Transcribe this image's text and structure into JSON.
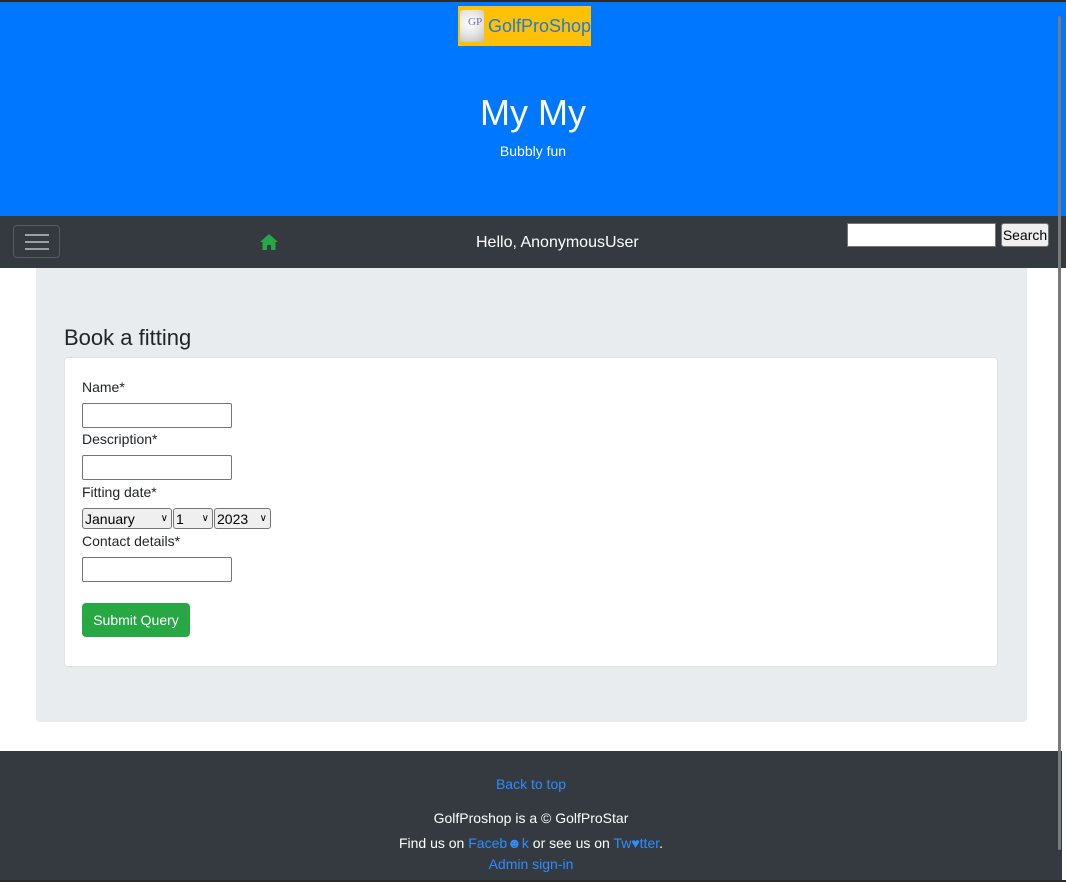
{
  "header": {
    "logo_text": "GolfProShop",
    "logo_mark": "GP",
    "title": "My My",
    "subtitle": "Bubbly fun"
  },
  "navbar": {
    "toggler_icon": "hamburger-icon",
    "home_icon": "home-icon",
    "greeting": "Hello, AnonymousUser",
    "search_value": "",
    "search_button": "Search"
  },
  "form": {
    "title": "Book a fitting",
    "name_label": "Name*",
    "description_label": "Description*",
    "fitting_date_label": "Fitting date*",
    "month": "January",
    "day": "1",
    "year": "2023",
    "contact_label": "Contact details*",
    "submit_label": "Submit Query"
  },
  "footer": {
    "back_to_top": "Back to top",
    "copyright": "GolfProshop is a © GolfProStar",
    "find_us_prefix": "Find us on ",
    "facebook": "Faceb☻k",
    "or_see": " or see us on ",
    "twitter": "Tw♥tter",
    "period": ".",
    "admin_link": "Admin sign-in"
  },
  "colors": {
    "hero": "#0077ff",
    "navbar": "#343a40",
    "panel": "#e9ecef",
    "submit": "#28a745",
    "logo_bg": "#ffc107",
    "link": "#2e8dff"
  }
}
